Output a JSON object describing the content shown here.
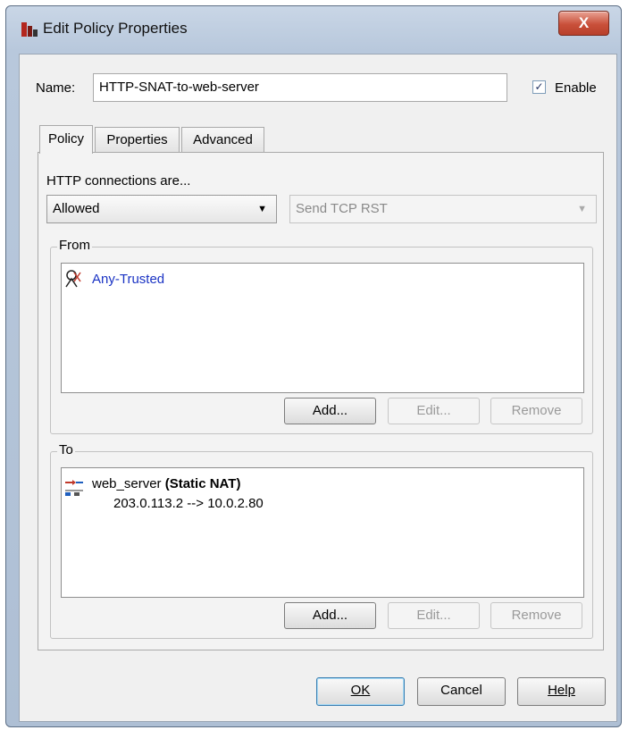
{
  "window": {
    "title": "Edit Policy Properties",
    "close_label": "X"
  },
  "name_row": {
    "label": "Name:",
    "value": "HTTP-SNAT-to-web-server",
    "enable_label": "Enable",
    "enable_checked": true
  },
  "tabs": [
    {
      "label": "Policy",
      "active": true
    },
    {
      "label": "Properties",
      "active": false
    },
    {
      "label": "Advanced",
      "active": false
    }
  ],
  "policy": {
    "connections_label": "HTTP connections are...",
    "action_value": "Allowed",
    "secondary_action_value": "Send TCP RST",
    "from": {
      "legend": "From",
      "items": [
        {
          "label": "Any-Trusted",
          "icon": "alias-icon"
        }
      ],
      "buttons": {
        "add": "Add...",
        "edit": "Edit...",
        "remove": "Remove"
      }
    },
    "to": {
      "legend": "To",
      "items": [
        {
          "name": "web_server",
          "type": "(Static NAT)",
          "mapping": "203.0.113.2 --> 10.0.2.80",
          "icon": "static-nat-icon"
        }
      ],
      "buttons": {
        "add": "Add...",
        "edit": "Edit...",
        "remove": "Remove"
      }
    }
  },
  "footer": {
    "ok_label": "OK",
    "cancel_label": "Cancel",
    "help_label": "Help"
  },
  "colors": {
    "link": "#1a33c4",
    "close_button": "#c9503a"
  }
}
